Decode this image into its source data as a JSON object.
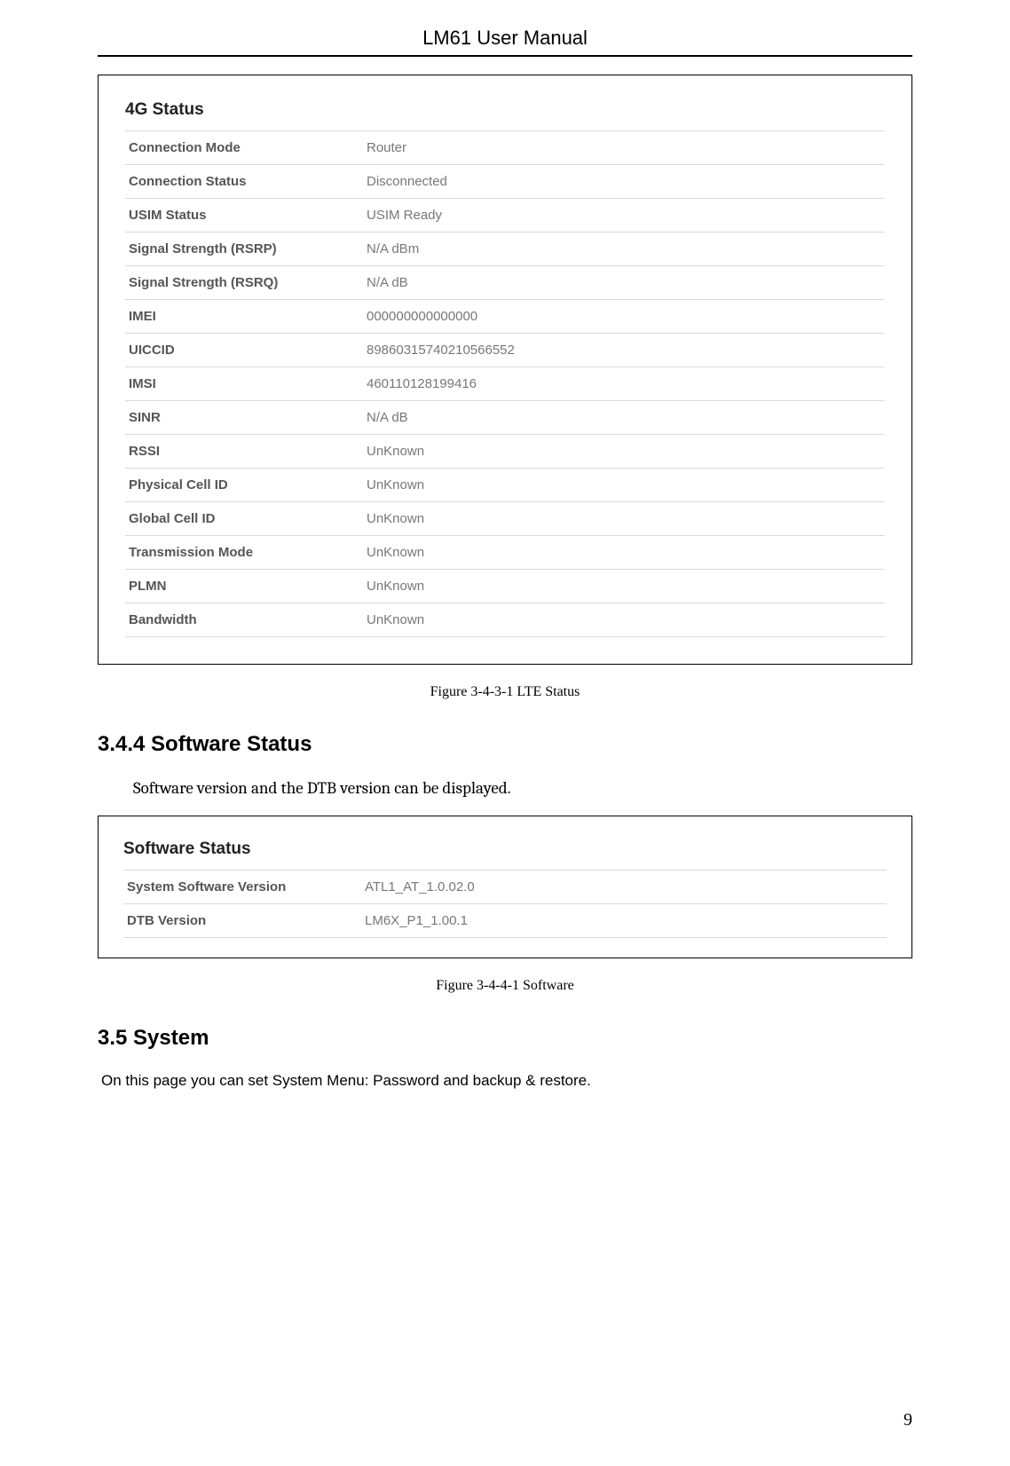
{
  "header": {
    "title": "LM61 User Manual"
  },
  "status_panel": {
    "title": "4G Status",
    "rows": [
      {
        "label": "Connection Mode",
        "value": "Router"
      },
      {
        "label": "Connection Status",
        "value": "Disconnected"
      },
      {
        "label": "USIM Status",
        "value": "USIM Ready"
      },
      {
        "label": "Signal Strength (RSRP)",
        "value": "N/A dBm"
      },
      {
        "label": "Signal Strength (RSRQ)",
        "value": "N/A dB"
      },
      {
        "label": "IMEI",
        "value": "000000000000000"
      },
      {
        "label": "UICCID",
        "value": "89860315740210566552"
      },
      {
        "label": "IMSI",
        "value": "460110128199416"
      },
      {
        "label": "SINR",
        "value": "N/A dB"
      },
      {
        "label": "RSSI",
        "value": "UnKnown"
      },
      {
        "label": "Physical Cell ID",
        "value": "UnKnown"
      },
      {
        "label": "Global Cell ID",
        "value": "UnKnown"
      },
      {
        "label": "Transmission Mode",
        "value": "UnKnown"
      },
      {
        "label": "PLMN",
        "value": "UnKnown"
      },
      {
        "label": "Bandwidth",
        "value": "UnKnown"
      }
    ]
  },
  "caption1": "Figure 3-4-3-1 LTE Status",
  "section_sw": {
    "heading": "3.4.4 Software Status",
    "body": "Software version and the DTB version can be displayed."
  },
  "software_panel": {
    "title": "Software Status",
    "rows": [
      {
        "label": "System Software Version",
        "value": "ATL1_AT_1.0.02.0"
      },
      {
        "label": "DTB Version",
        "value": "LM6X_P1_1.00.1"
      }
    ]
  },
  "caption2": "Figure 3-4-4-1 Software",
  "section_sys": {
    "heading": "3.5 System",
    "body": "On this page you can set System Menu: Password and backup & restore."
  },
  "page_number": "9"
}
